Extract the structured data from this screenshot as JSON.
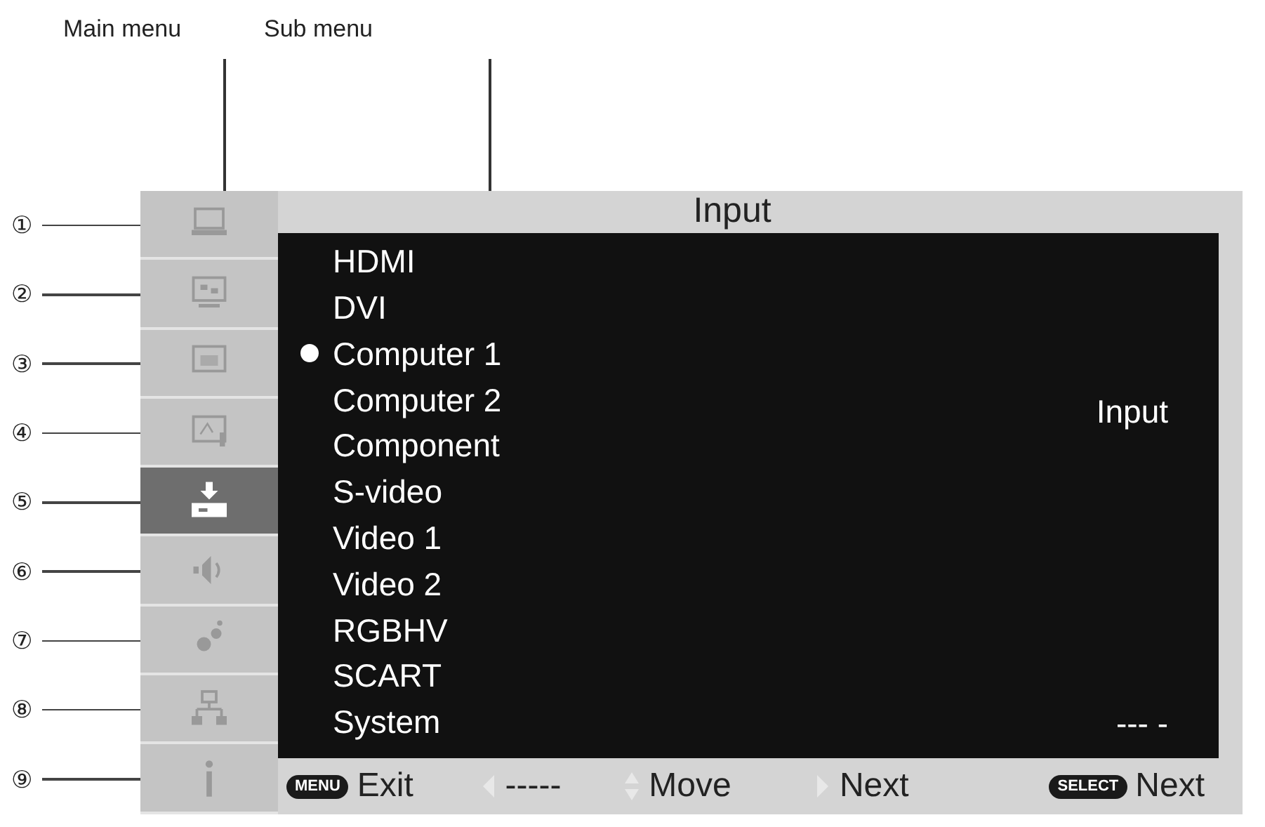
{
  "annotations": [
    {
      "label": "Main menu"
    },
    {
      "label": "Sub menu"
    }
  ],
  "main_menu": [
    {
      "callout": "①",
      "selected": false
    },
    {
      "callout": "②",
      "selected": false
    },
    {
      "callout": "③",
      "selected": false
    },
    {
      "callout": "④",
      "selected": false
    },
    {
      "callout": "⑤",
      "selected": true
    },
    {
      "callout": "⑥",
      "selected": false
    },
    {
      "callout": "⑦",
      "selected": false
    },
    {
      "callout": "⑧",
      "selected": false
    },
    {
      "callout": "⑨",
      "selected": false
    }
  ],
  "title": "Input",
  "sub_menu": [
    {
      "label": "HDMI",
      "selected": false
    },
    {
      "label": "DVI",
      "selected": false
    },
    {
      "label": "Computer 1",
      "selected": true
    },
    {
      "label": "Computer 2",
      "selected": false
    },
    {
      "label": "Component",
      "selected": false
    },
    {
      "label": "S-video",
      "selected": false
    },
    {
      "label": "Video 1",
      "selected": false
    },
    {
      "label": "Video 2",
      "selected": false
    },
    {
      "label": "RGBHV",
      "selected": false
    },
    {
      "label": "SCART",
      "selected": false
    },
    {
      "label": "System",
      "selected": false
    }
  ],
  "current_value": "Input",
  "system_value": "--- -",
  "footer": [
    {
      "kind": "key",
      "key": "MENU",
      "label": "Exit"
    },
    {
      "kind": "left",
      "label": "-----"
    },
    {
      "kind": "updown",
      "label": "Move"
    },
    {
      "kind": "right",
      "label": "Next"
    },
    {
      "kind": "key",
      "key": "SELECT",
      "label": "Next"
    }
  ]
}
